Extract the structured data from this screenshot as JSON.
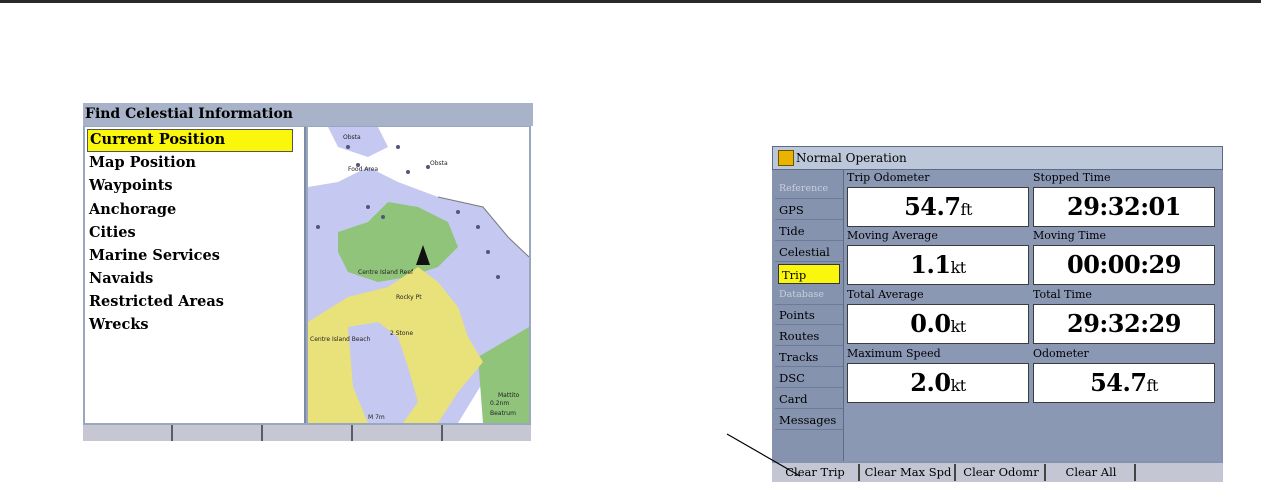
{
  "left_screen": {
    "title": "Find Celestial Information",
    "items": [
      {
        "label": "Current Position",
        "selected": true
      },
      {
        "label": "Map Position",
        "selected": false
      },
      {
        "label": "Waypoints",
        "selected": false
      },
      {
        "label": "Anchorage",
        "selected": false
      },
      {
        "label": "Cities",
        "selected": false
      },
      {
        "label": "Marine Services",
        "selected": false
      },
      {
        "label": "Navaids",
        "selected": false
      },
      {
        "label": "Restricted Areas",
        "selected": false
      },
      {
        "label": "Wrecks",
        "selected": false
      }
    ],
    "map_labels": {
      "a": "Food Area",
      "b": "Centre Island Reef",
      "c": "Rocky Pt",
      "d": "Centre Island Beach",
      "e": "2 Stone",
      "f": "Obsta",
      "g": "Obsta",
      "h": "M 7m",
      "i": "0.2nm",
      "j": "Mattito",
      "k": "Beatrum"
    },
    "colors": {
      "selection": "#fbf70c",
      "water": "#c5c8f0",
      "land": "#e9e27a",
      "shoal": "#8fc47a"
    }
  },
  "right_screen": {
    "title": "Normal Operation",
    "tabs": [
      {
        "label": "Reference",
        "type": "header"
      },
      {
        "label": "GPS",
        "type": "tab"
      },
      {
        "label": "Tide",
        "type": "tab"
      },
      {
        "label": "Celestial",
        "type": "tab"
      },
      {
        "label": "Trip",
        "type": "selected"
      },
      {
        "label": "Database",
        "type": "header"
      },
      {
        "label": "Points",
        "type": "tab"
      },
      {
        "label": "Routes",
        "type": "tab"
      },
      {
        "label": "Tracks",
        "type": "tab"
      },
      {
        "label": "DSC",
        "type": "tab"
      },
      {
        "label": "Card",
        "type": "tab"
      },
      {
        "label": "Messages",
        "type": "tab"
      }
    ],
    "fields": {
      "trip_odometer": {
        "label": "Trip Odometer",
        "value": "54.7",
        "unit": "ft"
      },
      "stopped_time": {
        "label": "Stopped Time",
        "value": "29:32:01",
        "unit": ""
      },
      "moving_average": {
        "label": "Moving Average",
        "value": "1.1",
        "unit": "kt"
      },
      "moving_time": {
        "label": "Moving Time",
        "value": "00:00:29",
        "unit": ""
      },
      "total_average": {
        "label": "Total Average",
        "value": "0.0",
        "unit": "kt"
      },
      "total_time": {
        "label": "Total Time",
        "value": "29:32:29",
        "unit": ""
      },
      "maximum_speed": {
        "label": "Maximum Speed",
        "value": "2.0",
        "unit": "kt"
      },
      "odometer": {
        "label": "Odometer",
        "value": "54.7",
        "unit": "ft"
      }
    },
    "buttons": {
      "clear_trip": "Clear Trip",
      "clear_max_spd": "Clear Max Spd",
      "clear_odomr": "Clear Odomr",
      "clear_all": "Clear All"
    },
    "colors": {
      "selection": "#fbf70c",
      "panel": "#8593af"
    }
  }
}
